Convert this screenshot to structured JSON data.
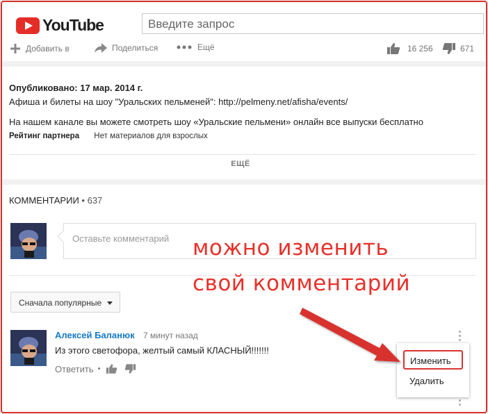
{
  "header": {
    "logo_text": "YouTube",
    "search_placeholder": "Введите запрос"
  },
  "actions": {
    "add_label": "Добавить в",
    "share_label": "Поделиться",
    "more_label": "Ещё",
    "likes": "16 256",
    "dislikes": "671"
  },
  "description": {
    "published": "Опубликовано: 17 мар. 2014 г.",
    "line1": "Афиша и билеты на шоу \"Уральских пельменей\": http://pelmeny.net/afisha/events/",
    "line2": "На нашем канале вы можете смотреть шоу «Уральские пельмени» онлайн все выпуски бесплатно",
    "meta_key": "Рейтинг партнера",
    "meta_value": "Нет материалов для взрослых",
    "more_label": "ЕЩЁ"
  },
  "comments": {
    "title": "КОММЕНТАРИИ",
    "count": "• 637",
    "input_placeholder": "Оставьте комментарий",
    "sort_label": "Сначала популярные",
    "item": {
      "author": "Алексей Баланюк",
      "time": "7 минут назад",
      "text": "Из этого светофора, желтый самый КЛАСНЫЙ!!!!!!!",
      "reply_label": "Ответить",
      "reply_sep": "•"
    },
    "menu": {
      "edit_label": "Изменить",
      "delete_label": "Удалить"
    }
  },
  "annotation": {
    "line1": "можно изменить",
    "line2": "свой комментарий"
  },
  "colors": {
    "accent_red": "#e52d27",
    "author_blue": "#167ac6",
    "annotation_red": "#e8312b"
  }
}
